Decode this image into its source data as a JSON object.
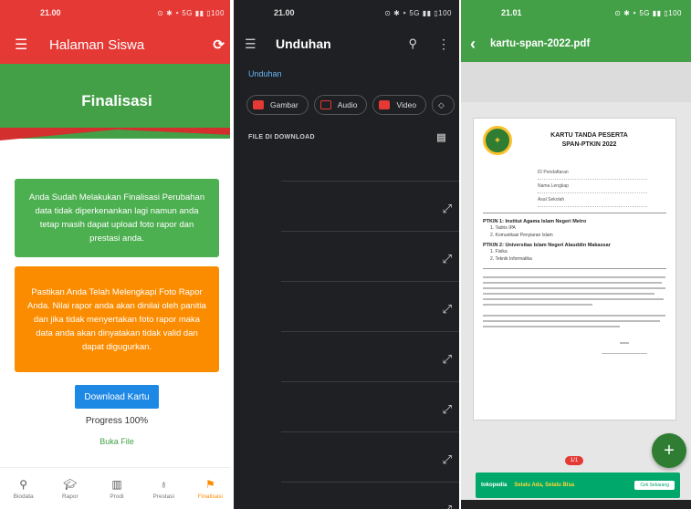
{
  "panel1": {
    "status_time": "21.00",
    "status_icons": "⊙ ✱ ⁍ 5G ▮▮ ▯100",
    "app_title": "Halaman Siswa",
    "hero_title": "Finalisasi",
    "green_card_text": "Anda Sudah Melakukan Finalisasi Perubahan data tidak diperkenankan lagi namun anda tetap masih dapat upload foto rapor dan prestasi anda.",
    "orange_card_text": "Pastikan Anda Telah Melengkapi Foto Rapor Anda. Nilai rapor anda akan dinilai oleh panitia dan jika tidak menyertakan foto rapor maka data anda akan dinyatakan tidak valid dan dapat digugurkan.",
    "download_label": "Download Kartu",
    "progress_text": "Progress 100%",
    "link_text": "Buka File",
    "nav": [
      {
        "label": "Biodata",
        "icon": "person-icon"
      },
      {
        "label": "Rapor",
        "icon": "school-icon"
      },
      {
        "label": "Prodi",
        "icon": "building-icon"
      },
      {
        "label": "Prestasi",
        "icon": "medal-icon"
      },
      {
        "label": "Finalisasi",
        "icon": "flag-icon"
      }
    ],
    "colors": {
      "red": "#e53935",
      "green": "#43a047",
      "orange": "#fb8c00",
      "blue": "#1e88e5"
    }
  },
  "panel2": {
    "status_time": "21.00",
    "status_icons": "⊙ ✱ ⁍ 5G ▮▮ ▯100",
    "title": "Unduhan",
    "breadcrumb": "Unduhan",
    "chips": [
      "Gambar",
      "Audio",
      "Video"
    ],
    "section_label": "FILE DI DOWNLOAD"
  },
  "panel3": {
    "status_time": "21.01",
    "status_icons": "⊙ ✱ ⁍ 5G ▮▮ ▯100",
    "title": "kartu-span-2022.pdf",
    "doc_title_1": "KARTU TANDA PESERTA",
    "doc_title_2": "SPAN-PTKIN 2022",
    "fields": [
      "ID Pendaftaran",
      "Nama Lengkap",
      "Asal Sekolah"
    ],
    "choice1": "PTKIN 1: Institut Agama Islam Negeri Metro",
    "choice1_items": [
      "1. Tadris IPA",
      "2. Komunikasi Penyiaran Islam"
    ],
    "choice2": "PTKIN 2: Universitas Islam Negeri Alauddin Makassar",
    "choice2_items": [
      "1. Fisika",
      "2. Teknik Informatika"
    ],
    "page_indicator": "1/1",
    "fab": "+",
    "ad_brand": "tokopedia",
    "ad_tagline": "Selalu Ada, Selalu Bisa",
    "ad_cta": "Cek Sekarang"
  }
}
